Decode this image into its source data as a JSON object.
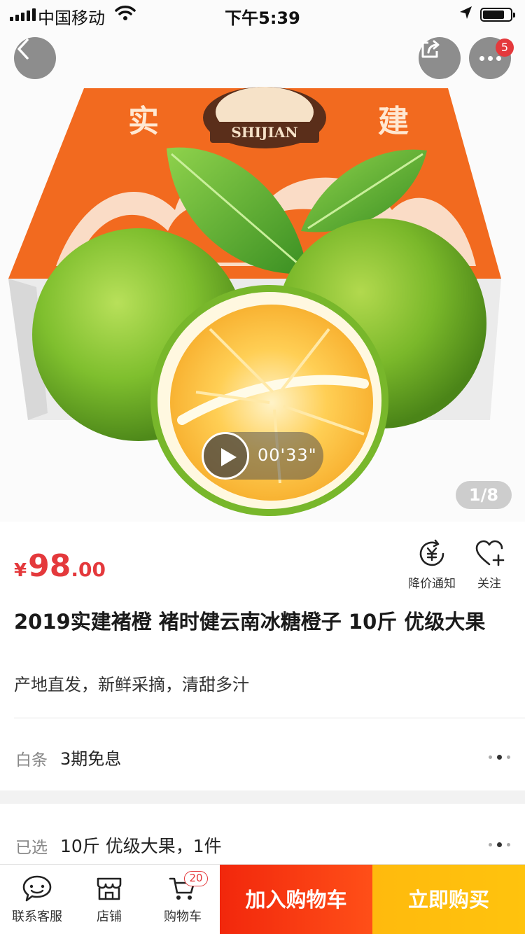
{
  "status_bar": {
    "carrier": "中国移动",
    "time": "下午5:39"
  },
  "gallery": {
    "video_duration": "00'33\"",
    "page_indicator": "1/8",
    "more_badge": "5",
    "box_brand_left": "实",
    "box_brand_right": "建",
    "box_logo": "SHIJIAN"
  },
  "product": {
    "price": {
      "symbol": "¥",
      "integer": "98",
      "decimal": ".00"
    },
    "title": "2019实建褚橙 褚时健云南冰糖橙子 10斤 优级大果",
    "subtitle": "产地直发，新鲜采摘，清甜多汁"
  },
  "actions": {
    "price_alert_label": "降价通知",
    "follow_label": "关注"
  },
  "installment": {
    "label": "白条",
    "value": "3期免息"
  },
  "selection": {
    "label": "已选",
    "value": "10斤 优级大果，1件"
  },
  "bottom_bar": {
    "service_label": "联系客服",
    "shop_label": "店铺",
    "cart_label": "购物车",
    "cart_count": "20",
    "add_to_cart_label": "加入购物车",
    "buy_now_label": "立即购买"
  },
  "colors": {
    "accent_red": "#e4393c",
    "add_cart_orange_red": "#f2270c",
    "buy_yellow": "#ffba0d",
    "box_orange": "#f26a1f",
    "fruit_green": "#7fbf2e"
  },
  "icons": [
    "back-icon",
    "share-icon",
    "more-icon",
    "price-alert-icon",
    "heart-plus-icon",
    "customer-service-icon",
    "shop-icon",
    "cart-icon",
    "play-icon"
  ]
}
